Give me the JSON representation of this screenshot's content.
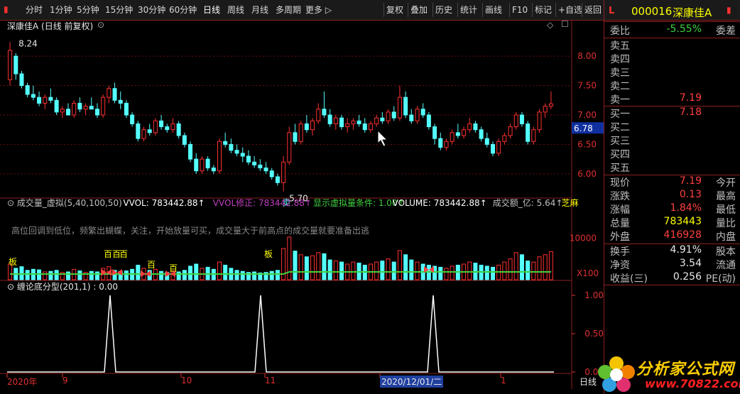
{
  "toolbar": {
    "periods": [
      "分时",
      "1分钟",
      "5分钟",
      "15分钟",
      "30分钟",
      "60分钟",
      "日线",
      "周线",
      "月线",
      "多周期",
      "更多"
    ],
    "tools": [
      "复权",
      "叠加",
      "历史",
      "统计",
      "画线",
      "F10",
      "标记",
      "+自选",
      "返回"
    ]
  },
  "price_panel": {
    "title": "深康佳A (日线 前复权)",
    "high_label": "8.24",
    "low_label": "5.70",
    "current_price_tag": "6.78",
    "sell_marker": "卖",
    "y_ticks": [
      "8.00",
      "7.50",
      "7.00",
      "6.50",
      "6.00"
    ]
  },
  "volume_panel": {
    "header": [
      {
        "text": "成交量_虚拟(5,40,100,50)",
        "color": "#c0c0c0"
      },
      {
        "text": "VVOL: 783442.88↑",
        "color": "#ffffff"
      },
      {
        "text": "VVOL修正: 783442.88↑",
        "color": "#c040c0"
      },
      {
        "text": "显示虚拟量条件: 1.00↑",
        "color": "#40d040"
      },
      {
        "text": "VOLUME: 783442.88↑",
        "color": "#ffffff"
      },
      {
        "text": "成交额_亿: 5.64↑",
        "color": "#c0c0c0"
      },
      {
        "text": "芝麻",
        "color": "#ffff00"
      }
    ],
    "note": "高位回调到低位，频繁出蝴蝶，关注，开始放量可买，成交量大于前高点的成交量就要准备出逃",
    "y_tick": "10000",
    "unit": "X100",
    "labels": [
      "板",
      "百百",
      "百",
      "百",
      "百百",
      "板"
    ]
  },
  "indicator_panel": {
    "title": "缠论底分型(201,1) : 0.00",
    "y_ticks": [
      "1.00",
      "0.50",
      "0.00"
    ]
  },
  "date_axis": {
    "labels": [
      "2020年",
      "9",
      "10",
      "11",
      "2020/12/01/二",
      "1"
    ],
    "period": "日线"
  },
  "stock_info": {
    "code": "000016",
    "name": "深康佳A",
    "l_icon": "L",
    "weibi_label": "委比",
    "weibi_val": "-5.55%",
    "weicha_label": "委差",
    "asks": [
      {
        "label": "卖五",
        "price": ""
      },
      {
        "label": "卖四",
        "price": ""
      },
      {
        "label": "卖三",
        "price": ""
      },
      {
        "label": "卖二",
        "price": ""
      },
      {
        "label": "卖一",
        "price": "7.19"
      }
    ],
    "bids": [
      {
        "label": "买一",
        "price": "7.18"
      },
      {
        "label": "买二",
        "price": ""
      },
      {
        "label": "买三",
        "price": ""
      },
      {
        "label": "买四",
        "price": ""
      },
      {
        "label": "买五",
        "price": ""
      }
    ],
    "quote": [
      {
        "l": "现价",
        "v": "7.19",
        "c": "red",
        "r": "今开"
      },
      {
        "l": "涨跌",
        "v": "0.13",
        "c": "red",
        "r": "最高"
      },
      {
        "l": "涨幅",
        "v": "1.84%",
        "c": "red",
        "r": "最低"
      },
      {
        "l": "总量",
        "v": "783443",
        "c": "yellow",
        "r": "量比"
      },
      {
        "l": "外盘",
        "v": "416928",
        "c": "red",
        "r": "内盘"
      }
    ],
    "stats": [
      {
        "l": "换手",
        "v": "4.91%",
        "r": "股本"
      },
      {
        "l": "净资",
        "v": "3.54",
        "r": "流通"
      },
      {
        "l": "收益(三)",
        "v": "0.256",
        "r": "PE(动)"
      }
    ]
  },
  "watermark": {
    "title": "分析家公式网",
    "url": "www.70822.com"
  },
  "chart_data": {
    "type": "candlestick",
    "price_range": [
      5.6,
      8.4
    ],
    "ohlc": [
      [
        7.6,
        8.24,
        7.5,
        8.1
      ],
      [
        8.0,
        8.05,
        7.6,
        7.7
      ],
      [
        7.7,
        7.75,
        7.45,
        7.5
      ],
      [
        7.5,
        7.55,
        7.3,
        7.35
      ],
      [
        7.35,
        7.5,
        7.25,
        7.3
      ],
      [
        7.3,
        7.4,
        7.15,
        7.2
      ],
      [
        7.2,
        7.35,
        7.1,
        7.3
      ],
      [
        7.3,
        7.45,
        7.2,
        7.25
      ],
      [
        7.25,
        7.3,
        7.0,
        7.05
      ],
      [
        7.05,
        7.15,
        6.95,
        7.1
      ],
      [
        7.1,
        7.2,
        7.0,
        7.0
      ],
      [
        7.0,
        7.25,
        6.95,
        7.2
      ],
      [
        7.2,
        7.3,
        7.05,
        7.1
      ],
      [
        7.1,
        7.2,
        7.0,
        7.15
      ],
      [
        7.15,
        7.3,
        7.1,
        7.1
      ],
      [
        7.1,
        7.2,
        6.95,
        7.0
      ],
      [
        7.0,
        7.35,
        6.95,
        7.3
      ],
      [
        7.3,
        7.5,
        7.2,
        7.45
      ],
      [
        7.45,
        7.55,
        7.2,
        7.25
      ],
      [
        7.25,
        7.4,
        7.1,
        7.2
      ],
      [
        7.2,
        7.25,
        6.95,
        7.0
      ],
      [
        7.0,
        7.05,
        6.8,
        6.85
      ],
      [
        6.85,
        6.9,
        6.55,
        6.6
      ],
      [
        6.6,
        6.8,
        6.55,
        6.75
      ],
      [
        6.75,
        6.85,
        6.65,
        6.7
      ],
      [
        6.7,
        6.95,
        6.65,
        6.9
      ],
      [
        6.9,
        7.0,
        6.75,
        6.8
      ],
      [
        6.8,
        6.85,
        6.7,
        6.75
      ],
      [
        6.75,
        6.95,
        6.7,
        6.85
      ],
      [
        6.85,
        6.9,
        6.6,
        6.65
      ],
      [
        6.65,
        6.7,
        6.45,
        6.5
      ],
      [
        6.5,
        6.55,
        6.2,
        6.25
      ],
      [
        6.25,
        6.35,
        6.0,
        6.05
      ],
      [
        6.05,
        6.3,
        6.0,
        6.25
      ],
      [
        6.25,
        6.3,
        6.05,
        6.1
      ],
      [
        6.1,
        6.15,
        6.0,
        6.05
      ],
      [
        6.05,
        6.6,
        6.0,
        6.55
      ],
      [
        6.55,
        6.7,
        6.45,
        6.5
      ],
      [
        6.5,
        6.6,
        6.35,
        6.4
      ],
      [
        6.4,
        6.5,
        6.3,
        6.35
      ],
      [
        6.35,
        6.45,
        6.2,
        6.3
      ],
      [
        6.3,
        6.4,
        6.15,
        6.2
      ],
      [
        6.2,
        6.3,
        6.1,
        6.15
      ],
      [
        6.15,
        6.25,
        6.05,
        6.1
      ],
      [
        6.1,
        6.2,
        6.0,
        6.05
      ],
      [
        6.05,
        6.1,
        5.9,
        5.95
      ],
      [
        5.95,
        6.0,
        5.8,
        5.85
      ],
      [
        5.85,
        6.3,
        5.7,
        6.2
      ],
      [
        6.2,
        6.8,
        6.15,
        6.7
      ],
      [
        6.7,
        6.85,
        6.5,
        6.55
      ],
      [
        6.55,
        6.9,
        6.5,
        6.85
      ],
      [
        6.85,
        7.0,
        6.7,
        6.75
      ],
      [
        6.75,
        6.95,
        6.65,
        6.9
      ],
      [
        6.9,
        7.2,
        6.85,
        7.1
      ],
      [
        7.1,
        7.4,
        6.95,
        7.0
      ],
      [
        7.0,
        7.1,
        6.8,
        6.85
      ],
      [
        6.85,
        7.0,
        6.75,
        6.95
      ],
      [
        6.95,
        7.0,
        6.75,
        6.8
      ],
      [
        6.8,
        6.95,
        6.7,
        6.85
      ],
      [
        6.85,
        6.95,
        6.75,
        6.9
      ],
      [
        6.9,
        7.0,
        6.8,
        6.85
      ],
      [
        6.85,
        6.95,
        6.7,
        6.75
      ],
      [
        6.75,
        6.9,
        6.7,
        6.85
      ],
      [
        6.85,
        7.0,
        6.8,
        6.95
      ],
      [
        6.95,
        7.05,
        6.85,
        6.9
      ],
      [
        6.9,
        7.1,
        6.85,
        7.05
      ],
      [
        7.05,
        7.15,
        6.9,
        6.95
      ],
      [
        6.95,
        7.5,
        6.9,
        7.3
      ],
      [
        7.3,
        7.4,
        6.95,
        7.0
      ],
      [
        7.0,
        7.1,
        6.85,
        6.9
      ],
      [
        6.9,
        7.15,
        6.85,
        7.1
      ],
      [
        7.1,
        7.2,
        6.95,
        7.0
      ],
      [
        7.0,
        7.05,
        6.75,
        6.8
      ],
      [
        6.8,
        6.85,
        6.5,
        6.6
      ],
      [
        6.6,
        6.7,
        6.4,
        6.45
      ],
      [
        6.45,
        6.6,
        6.4,
        6.55
      ],
      [
        6.55,
        6.75,
        6.5,
        6.7
      ],
      [
        6.7,
        6.85,
        6.6,
        6.65
      ],
      [
        6.65,
        6.8,
        6.6,
        6.75
      ],
      [
        6.75,
        6.95,
        6.7,
        6.85
      ],
      [
        6.85,
        6.9,
        6.7,
        6.75
      ],
      [
        6.75,
        6.8,
        6.55,
        6.6
      ],
      [
        6.6,
        6.7,
        6.45,
        6.5
      ],
      [
        6.5,
        6.55,
        6.3,
        6.35
      ],
      [
        6.35,
        6.6,
        6.3,
        6.55
      ],
      [
        6.55,
        6.7,
        6.5,
        6.65
      ],
      [
        6.65,
        6.85,
        6.6,
        6.8
      ],
      [
        6.8,
        7.05,
        6.75,
        7.0
      ],
      [
        7.0,
        7.05,
        6.8,
        6.85
      ],
      [
        6.85,
        6.9,
        6.5,
        6.55
      ],
      [
        6.55,
        6.8,
        6.5,
        6.75
      ],
      [
        6.75,
        7.1,
        6.7,
        7.05
      ],
      [
        7.05,
        7.2,
        6.95,
        7.15
      ],
      [
        7.15,
        7.4,
        7.1,
        7.19
      ]
    ],
    "volume": [
      30,
      22,
      25,
      18,
      20,
      19,
      15,
      16,
      18,
      14,
      15,
      20,
      17,
      14,
      16,
      15,
      22,
      25,
      18,
      16,
      17,
      20,
      28,
      22,
      18,
      20,
      16,
      14,
      17,
      15,
      18,
      26,
      30,
      22,
      24,
      20,
      34,
      28,
      22,
      18,
      16,
      14,
      15,
      13,
      14,
      16,
      18,
      60,
      82,
      55,
      48,
      44,
      46,
      52,
      50,
      38,
      36,
      34,
      30,
      34,
      32,
      28,
      30,
      34,
      36,
      40,
      34,
      56,
      48,
      38,
      34,
      30,
      28,
      26,
      24,
      22,
      26,
      28,
      30,
      34,
      32,
      28,
      26,
      24,
      28,
      34,
      40,
      52,
      48,
      36,
      34,
      44,
      48,
      54
    ],
    "signals": [
      23,
      73,
      142,
      220
    ],
    "signal_range": [
      0,
      1
    ]
  }
}
